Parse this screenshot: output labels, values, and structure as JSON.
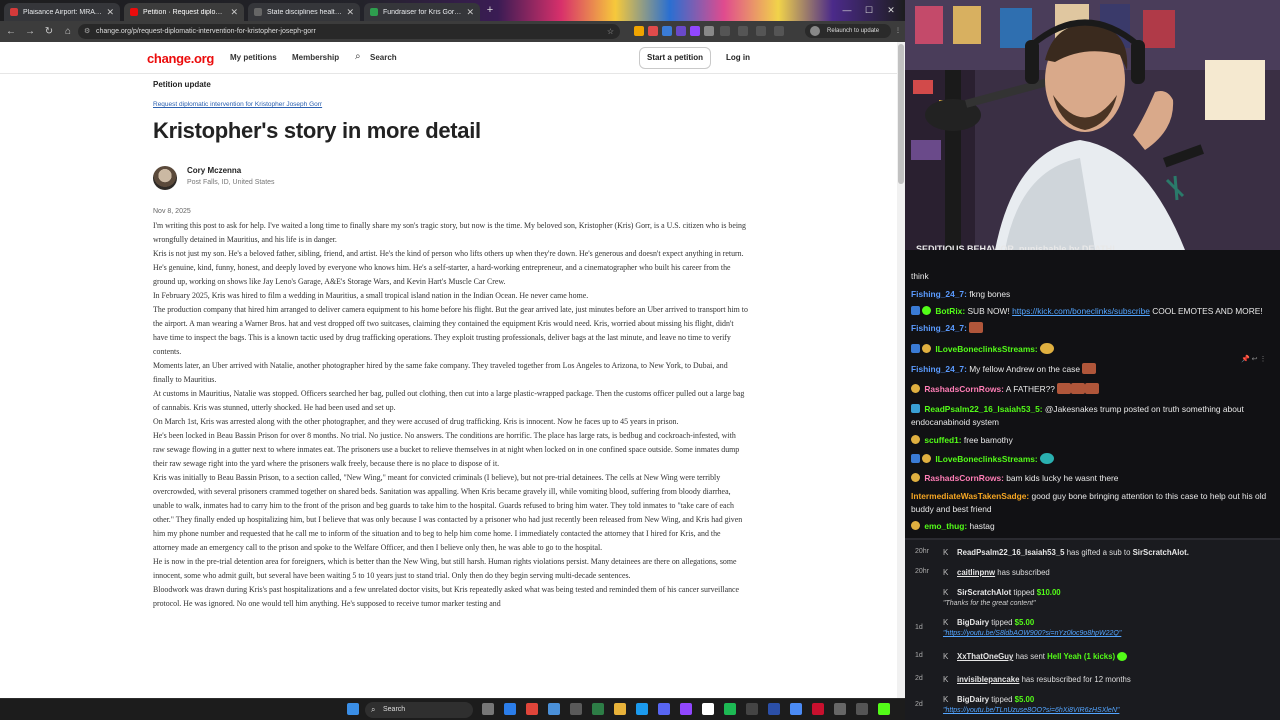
{
  "browser": {
    "tabs": [
      {
        "title": "Plaisance Airport: MRA Busted",
        "fav_color": "#d33a3a",
        "active": false
      },
      {
        "title": "Petition · Request diplomatic in",
        "fav_color": "#eb0c0c",
        "active": true
      },
      {
        "title": "State disciplines health care pro",
        "fav_color": "#666666",
        "active": false
      },
      {
        "title": "Fundraiser for Kris Gorr by Kelli",
        "fav_color": "#2e9e4e",
        "active": false
      }
    ],
    "url": "change.org/p/request-diplomatic-intervention-for-kristopher-joseph-gorr",
    "relaunch_label": "Relaunch to update"
  },
  "site": {
    "logo": "change.org",
    "nav_my_petitions": "My petitions",
    "nav_membership": "Membership",
    "nav_search": "Search",
    "start_petition": "Start a petition",
    "login": "Log in",
    "brand_color": "#eb0c0c"
  },
  "post": {
    "section_label": "Petition update",
    "petition_link": "Request diplomatic intervention for Kristopher Joseph Gorr",
    "title": "Kristopher's story in more detail",
    "author_name": "Cory Mczenna",
    "author_location": "Post Falls, ID, United States",
    "date": "Nov 8, 2025",
    "paragraphs": [
      "I'm writing this post to ask for help. I've waited a long time to finally share my son's tragic story, but now is the time. My beloved son, Kristopher (Kris) Gorr, is a U.S. citizen who is being wrongfully detained in Mauritius, and his life is in danger.",
      "Kris is not just my son. He's a beloved father, sibling, friend, and artist. He's the kind of person who lifts others up when they're down. He's generous and doesn't expect anything in return. He's genuine, kind, funny, honest, and deeply loved by everyone who knows him. He's a self-starter, a hard-working entrepreneur, and a cinematographer who built his career from the ground up, working on shows like Jay Leno's Garage, A&E's Storage Wars, and Kevin Hart's Muscle Car Crew.",
      "In February 2025, Kris was hired to film a wedding in Mauritius, a small tropical island nation in the Indian Ocean. He never came home.",
      "  The production company that hired him arranged to deliver camera equipment to his home before his flight. But the gear arrived late, just minutes before an Uber arrived to transport him to the airport. A man wearing a Warner Bros. hat and vest dropped off two suitcases, claiming they contained the equipment Kris would need. Kris, worried about missing his flight, didn't have time to inspect the bags. This is a known tactic used by drug trafficking operations. They exploit trusting professionals, deliver bags at the last minute, and leave no time to verify contents.",
      "  Moments later, an Uber arrived with Natalie, another photographer hired by the same fake company. They traveled together from Los Angeles to Arizona, to New York, to Dubai, and finally to Mauritius.",
      "  At customs in Mauritius, Natalie was stopped. Officers searched her bag, pulled out clothing, then cut into a large plastic-wrapped package. Then the customs officer pulled out a large bag of cannabis. Kris was stunned, utterly shocked. He had been used and set up.",
      "On March 1st, Kris was arrested along with the other photographer, and they were accused of drug trafficking. Kris is innocent. Now he faces up to 45 years in prison.",
      "He's been locked in Beau Bassin Prison for over 8 months. No trial. No justice. No answers. The conditions are horrific. The place has large rats, is bedbug and cockroach-infested, with raw sewage flowing in a gutter next to where inmates eat. The prisoners use a bucket to relieve themselves in at night when locked on in one confined space outside. Some inmates dump their raw sewage right into the yard where the prisoners walk freely, because there is no place to dispose of it.",
      "Kris was initially to Beau Bassin Prison, to a section called, \"New Wing,\" meant for convicted criminals (I believe), but not pre-trial detainees. The cells at New Wing were terribly overcrowded, with several prisoners crammed together on shared beds. Sanitation was appalling. When Kris became gravely ill, while vomiting blood, suffering from bloody diarrhea, unable to walk, inmates had to carry him to the front of the prison and beg guards to take him to the hospital. Guards refused to bring him water. They told inmates to \"take care of each other.\" They finally ended up hospitalizing him, but I believe that was only because I was contacted by a prisoner who had just recently been released from New Wing, and Kris had given him my phone number and requested that he call me to inform of the situation and to beg to help him come home. I immediately contacted the attorney that I hired for Kris, and the attorney made an emergency call to the prison and spoke to the Welfare Officer, and then I believe only then, he was able to go to the hospital.",
      "He is now in the pre-trial detention area for foreigners, which is better than the New Wing, but still harsh. Human rights violations persist. Many detainees are there on allegations, some innocent, some who admit guilt, but several have been waiting 5 to 10 years just to stand trial. Only then do they begin serving multi-decade sentences.",
      "  Bloodwork was drawn during Kris's past hospitalizations and a few unrelated doctor visits, but Kris repeatedly asked what was being tested and reminded them of his cancer surveillance protocol. He was ignored. No one would tell him anything. He's supposed to receive tumor marker testing and"
    ]
  },
  "taskbar": {
    "search_label": "Search"
  },
  "stream": {
    "overlay_text": "SEDITIOUS BEHAVIOR, punishable by DEATH!"
  },
  "chat": {
    "messages": [
      {
        "user": "",
        "text": "think",
        "color": "#ffffff"
      },
      {
        "user": "Fishing_24_7:",
        "text": "fkng bones",
        "color": "#5b9bff"
      },
      {
        "user": "BotRix:",
        "text": "SUB NOW!",
        "link": "https://kick.com/boneclinks/subscribe",
        "after": "COOL EMOTES AND MORE!",
        "color": "#53fc18"
      },
      {
        "user": "Fishing_24_7:",
        "text": "",
        "color": "#5b9bff"
      },
      {
        "user": "ILoveBoneclinksStreams:",
        "text": "",
        "color": "#53fc18"
      },
      {
        "user": "Fishing_24_7:",
        "text": "My fellow Andrew on the case",
        "color": "#5b9bff"
      },
      {
        "user": "RashadsCornRows:",
        "text": "A FATHER??",
        "color": "#ff7eb6"
      },
      {
        "user": "ReadPsalm22_16_Isaiah53_5:",
        "text": "@Jakesnakes trump posted on truth something about endocanabinoid system",
        "color": "#53fc18"
      },
      {
        "user": "scuffed1:",
        "text": "free bamothy",
        "color": "#53fc18"
      },
      {
        "user": "ILoveBoneclinksStreams:",
        "text": "",
        "color": "#53fc18"
      },
      {
        "user": "RashadsCornRows:",
        "text": "bam kids lucky he wasnt there",
        "color": "#ff7eb6"
      },
      {
        "user": "IntermediateWasTakenSadge:",
        "text": "good guy bone bringing attention to this case to help out his old buddy and best friend",
        "color": "#f5a623"
      },
      {
        "user": "emo_thug:",
        "text": "hastag",
        "color": "#53fc18"
      }
    ]
  },
  "events": [
    {
      "time": "20hr",
      "name": "ReadPsalm22_16_Isaiah53_5",
      "text": "has gifted a sub to",
      "target": "SirScratchAlot.",
      "sub": ""
    },
    {
      "time": "20hr",
      "name": "caitlinpnw",
      "text": "has subscribed",
      "target": "",
      "sub": ""
    },
    {
      "time": "",
      "name": "SirScratchAlot",
      "text": "tipped",
      "target": "$10.00",
      "sub": "\"Thanks for the great content\""
    },
    {
      "time": "1d",
      "name": "BigDairy",
      "text": "tipped",
      "target": "$5.00",
      "sub": "\"https://youtu.be/S8ldbAOW900?si=nYz0loc9o8hpW22Q\""
    },
    {
      "time": "1d",
      "name": "XxThatOneGuy",
      "text": "has sent",
      "target": "Hell Yeah (1 kicks)",
      "sub": ""
    },
    {
      "time": "2d",
      "name": "invisiblepancake",
      "text": "has resubscribed for 12 months",
      "target": "",
      "sub": ""
    },
    {
      "time": "2d",
      "name": "BigDairy",
      "text": "tipped",
      "target": "$5.00",
      "sub": "\"https://youtu.be/TLnUzuse8OO?si=6hXi8VIR6zHSXleN\""
    }
  ]
}
